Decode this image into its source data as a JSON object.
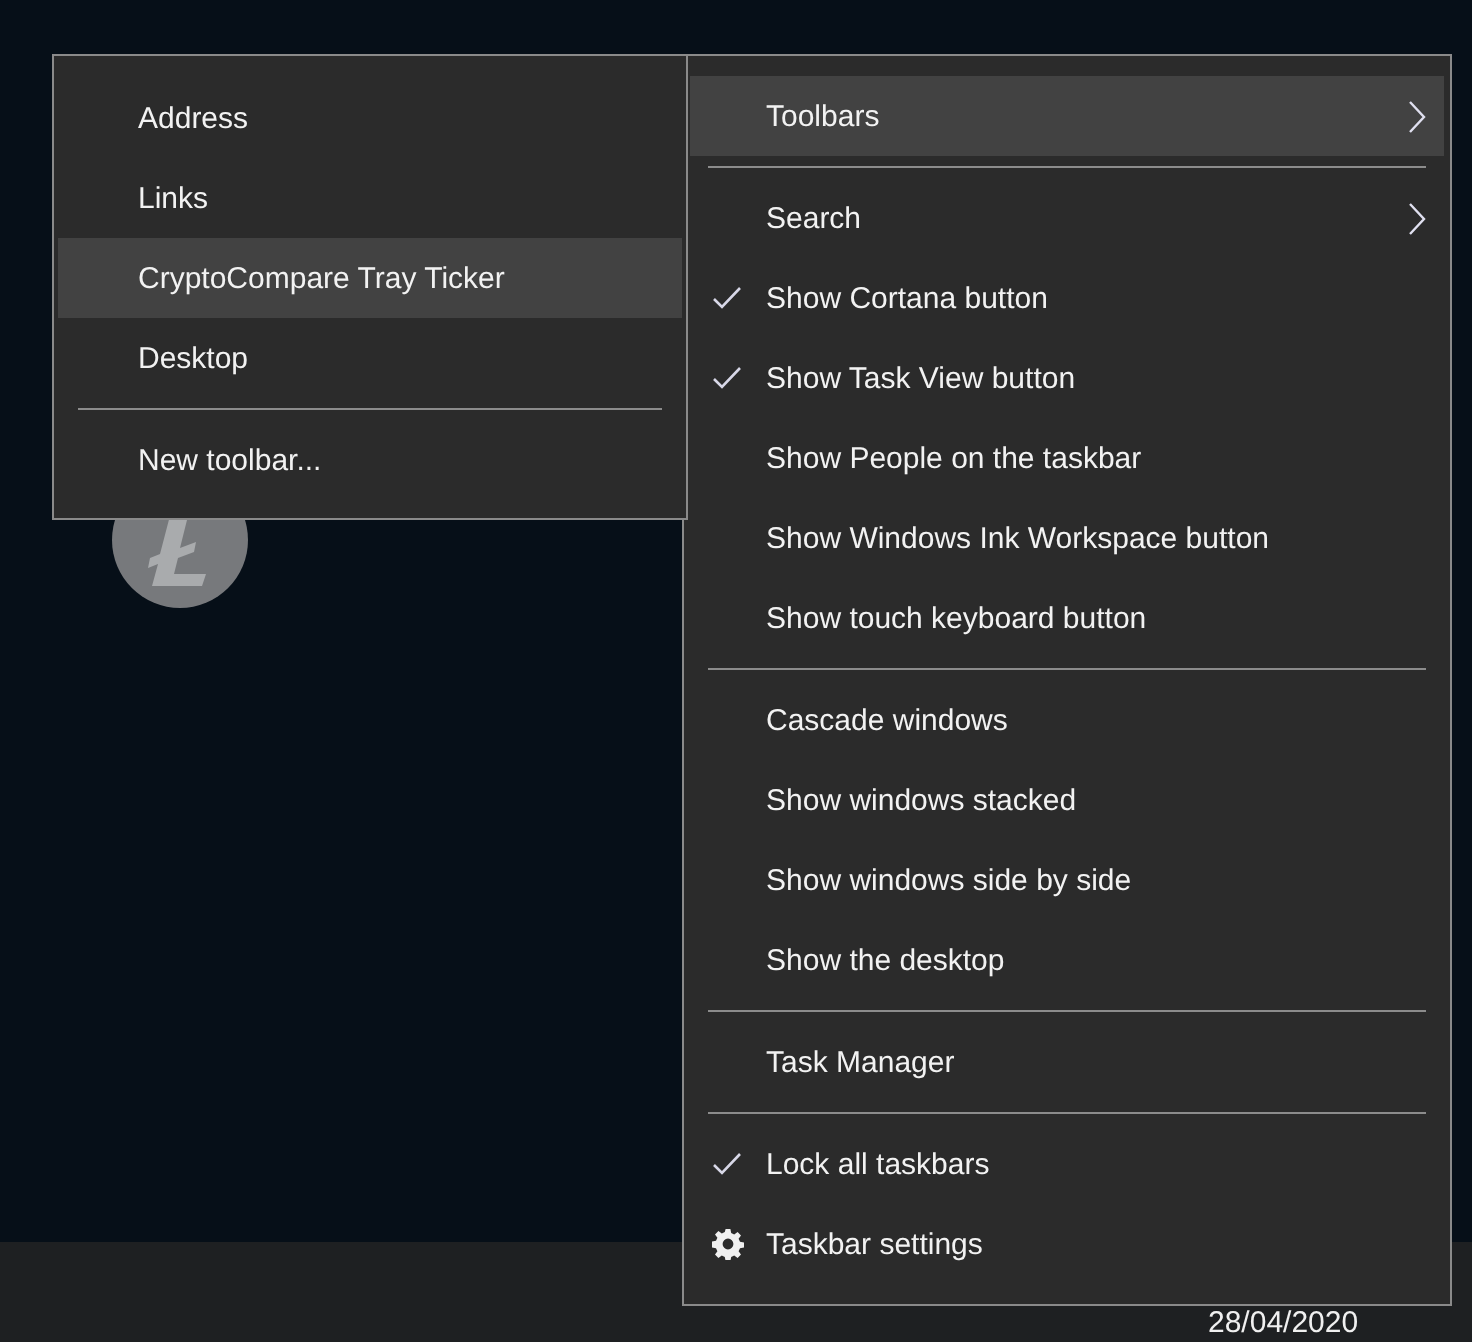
{
  "taskbar": {
    "clock_date": "28/04/2020"
  },
  "context_menu": {
    "sections": [
      [
        {
          "label": "Toolbars",
          "kind": "submenu",
          "selected": true
        }
      ],
      [
        {
          "label": "Search",
          "kind": "submenu",
          "selected": false
        },
        {
          "label": "Show Cortana button",
          "kind": "item",
          "checked": true,
          "selected": false
        },
        {
          "label": "Show Task View button",
          "kind": "item",
          "checked": true,
          "selected": false
        },
        {
          "label": "Show People on the taskbar",
          "kind": "item",
          "checked": false,
          "selected": false
        },
        {
          "label": "Show Windows Ink Workspace button",
          "kind": "item",
          "checked": false,
          "selected": false
        },
        {
          "label": "Show touch keyboard button",
          "kind": "item",
          "checked": false,
          "selected": false
        }
      ],
      [
        {
          "label": "Cascade windows",
          "kind": "item",
          "selected": false
        },
        {
          "label": "Show windows stacked",
          "kind": "item",
          "selected": false
        },
        {
          "label": "Show windows side by side",
          "kind": "item",
          "selected": false
        },
        {
          "label": "Show the desktop",
          "kind": "item",
          "selected": false
        }
      ],
      [
        {
          "label": "Task Manager",
          "kind": "item",
          "selected": false
        }
      ],
      [
        {
          "label": "Lock all taskbars",
          "kind": "item",
          "checked": true,
          "selected": false
        },
        {
          "label": "Taskbar settings",
          "kind": "settings",
          "selected": false
        }
      ]
    ]
  },
  "toolbars_submenu": {
    "sections": [
      [
        {
          "label": "Address",
          "checked": false,
          "selected": false
        },
        {
          "label": "Links",
          "checked": false,
          "selected": false
        },
        {
          "label": "CryptoCompare Tray Ticker",
          "checked": false,
          "selected": true
        },
        {
          "label": "Desktop",
          "checked": false,
          "selected": false
        }
      ],
      [
        {
          "label": "New toolbar...",
          "selected": false
        }
      ]
    ]
  }
}
